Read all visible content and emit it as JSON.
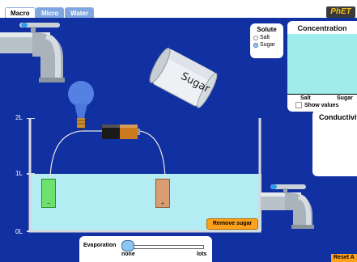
{
  "tabs": [
    {
      "label": "Macro",
      "active": true
    },
    {
      "label": "Micro",
      "active": false
    },
    {
      "label": "Water",
      "active": false
    }
  ],
  "logo": "PhET",
  "solute": {
    "title": "Solute",
    "options": [
      "Salt",
      "Sugar"
    ],
    "selected": "Sugar"
  },
  "concentration": {
    "title": "Concentration",
    "bars": [
      "Salt",
      "Sugar"
    ],
    "show_values_label": "Show values",
    "show_values_checked": false
  },
  "conductivity": {
    "title": "Conductivity"
  },
  "shaker": {
    "label": "Sugar"
  },
  "beaker": {
    "ticks": [
      "2L",
      "1L",
      "0L"
    ]
  },
  "electrodes": {
    "negative": "−",
    "positive": "+"
  },
  "buttons": {
    "remove": "Remove sugar",
    "reset": "Reset A"
  },
  "evaporation": {
    "label": "Evaporation",
    "min_label": "none",
    "max_label": "lots",
    "value": 0
  },
  "colors": {
    "background": "#1130a2",
    "water": "#b4ecf3",
    "button": "#ffa11a"
  }
}
